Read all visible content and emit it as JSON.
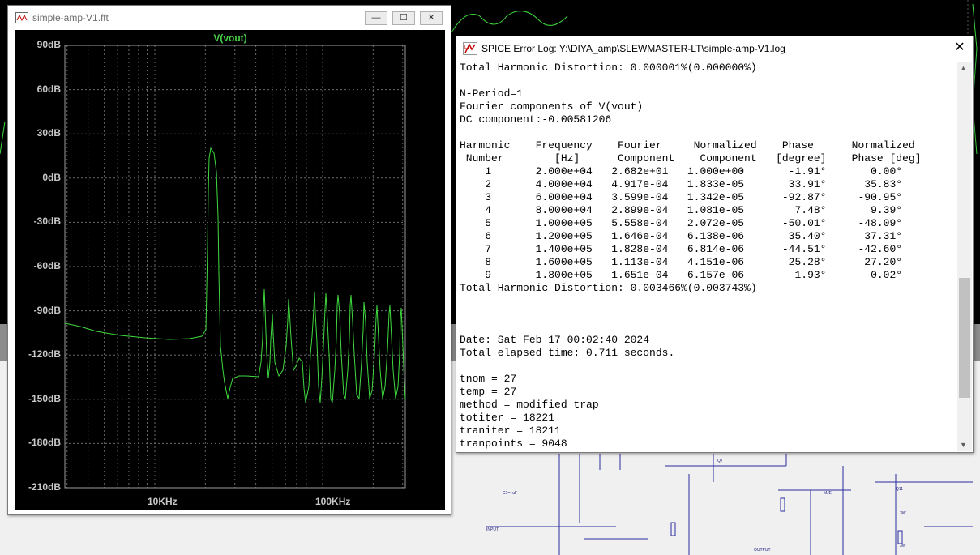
{
  "fft_window": {
    "title": "simple-amp-V1.fft",
    "trace_label": "V(vout)",
    "y_axis_labels": [
      "90dB",
      "60dB",
      "30dB",
      "0dB",
      "-30dB",
      "-60dB",
      "-90dB",
      "-120dB",
      "-150dB",
      "-180dB",
      "-210dB"
    ],
    "x_axis_labels": [
      "10KHz",
      "100KHz"
    ],
    "trace_color": "#3fd93f",
    "buttons": {
      "minimize": "—",
      "restore": "☐",
      "close": "✕"
    }
  },
  "log_window": {
    "title": "SPICE Error Log: Y:\\DIYA_amp\\SLEWMASTER-LT\\simple-amp-V1.log",
    "close_label": "✕",
    "lines": [
      "Total Harmonic Distortion: 0.000001%(0.000000%)",
      "",
      "N-Period=1",
      "Fourier components of V(vout)",
      "DC component:-0.00581206",
      "",
      "Harmonic    Frequency    Fourier     Normalized    Phase      Normalized",
      " Number        [Hz]      Component    Component   [degree]    Phase [deg]",
      "    1       2.000e+04   2.682e+01   1.000e+00       -1.91°       0.00°",
      "    2       4.000e+04   4.917e-04   1.833e-05       33.91°      35.83°",
      "    3       6.000e+04   3.599e-04   1.342e-05      -92.87°     -90.95°",
      "    4       8.000e+04   2.899e-04   1.081e-05        7.48°       9.39°",
      "    5       1.000e+05   5.558e-04   2.072e-05      -50.01°     -48.09°",
      "    6       1.200e+05   1.646e-04   6.138e-06       35.40°      37.31°",
      "    7       1.400e+05   1.828e-04   6.814e-06      -44.51°     -42.60°",
      "    8       1.600e+05   1.113e-04   4.151e-06       25.28°      27.20°",
      "    9       1.800e+05   1.651e-04   6.157e-06       -1.93°      -0.02°",
      "Total Harmonic Distortion: 0.003466%(0.003743%)",
      "",
      "",
      "",
      "Date: Sat Feb 17 00:02:40 2024",
      "Total elapsed time: 0.711 seconds.",
      "",
      "tnom = 27",
      "temp = 27",
      "method = modified trap",
      "totiter = 18221",
      "traniter = 18211",
      "tranpoints = 9048"
    ]
  }
}
